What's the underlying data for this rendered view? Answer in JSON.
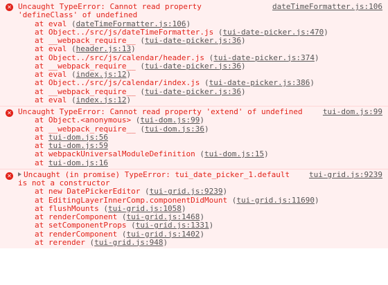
{
  "errors": [
    {
      "message_line1": "Uncaught TypeError: Cannot read property",
      "message_line2": "'defineClass' of undefined",
      "source": "dateTimeFormatter.js:106",
      "frames": [
        {
          "fn": "at eval ",
          "loc": "dateTimeFormatter.js:106"
        },
        {
          "fn": "at Object../src/js/dateTimeFormatter.js ",
          "loc": "tui-date-picker.js:470"
        },
        {
          "fn": "at __webpack_require__ ",
          "loc": "tui-date-picker.js:36"
        },
        {
          "fn": "at eval ",
          "loc": "header.js:13"
        },
        {
          "fn": "at Object../src/js/calendar/header.js ",
          "loc": "tui-date-picker.js:374"
        },
        {
          "fn": "at __webpack_require__ ",
          "loc": "tui-date-picker.js:36"
        },
        {
          "fn": "at eval ",
          "loc": "index.js:12"
        },
        {
          "fn": "at Object../src/js/calendar/index.js ",
          "loc": "tui-date-picker.js:386"
        },
        {
          "fn": "at __webpack_require__ ",
          "loc": "tui-date-picker.js:36"
        },
        {
          "fn": "at eval ",
          "loc": "index.js:12"
        }
      ]
    },
    {
      "message_line1": "Uncaught TypeError: Cannot read property 'extend' of undefined",
      "source": "tui-dom.js:99",
      "frames": [
        {
          "fn": "at Object.<anonymous> ",
          "loc": "tui-dom.js:99"
        },
        {
          "fn": "at __webpack_require__ ",
          "loc": "tui-dom.js:36"
        },
        {
          "fn": "at ",
          "loc": "tui-dom.js:56",
          "bare": true
        },
        {
          "fn": "at ",
          "loc": "tui-dom.js:59",
          "bare": true
        },
        {
          "fn": "at webpackUniversalModuleDefinition ",
          "loc": "tui-dom.js:15"
        },
        {
          "fn": "at ",
          "loc": "tui-dom.js:16",
          "bare": true
        }
      ]
    },
    {
      "message_line1": "Uncaught (in promise) TypeError: tui_date_picker_1.default",
      "message_line2": "is not a constructor",
      "source": "tui-grid.js:9239",
      "frames": [
        {
          "fn": "at new DatePickerEditor ",
          "loc": "tui-grid.js:9239"
        },
        {
          "fn": "at EditingLayerInnerComp.componentDidMount ",
          "loc": "tui-grid.js:11690"
        },
        {
          "fn": "at flushMounts ",
          "loc": "tui-grid.js:1058"
        },
        {
          "fn": "at renderComponent ",
          "loc": "tui-grid.js:1468"
        },
        {
          "fn": "at setComponentProps ",
          "loc": "tui-grid.js:1331"
        },
        {
          "fn": "at renderComponent ",
          "loc": "tui-grid.js:1402"
        },
        {
          "fn": "at rerender ",
          "loc": "tui-grid.js:948"
        }
      ]
    }
  ],
  "icons": {
    "error": "x-circle-icon",
    "expand": "triangle-right-icon"
  },
  "colors": {
    "error_text": "#e2231a",
    "error_bg": "#fff0f0",
    "link": "#555555"
  }
}
